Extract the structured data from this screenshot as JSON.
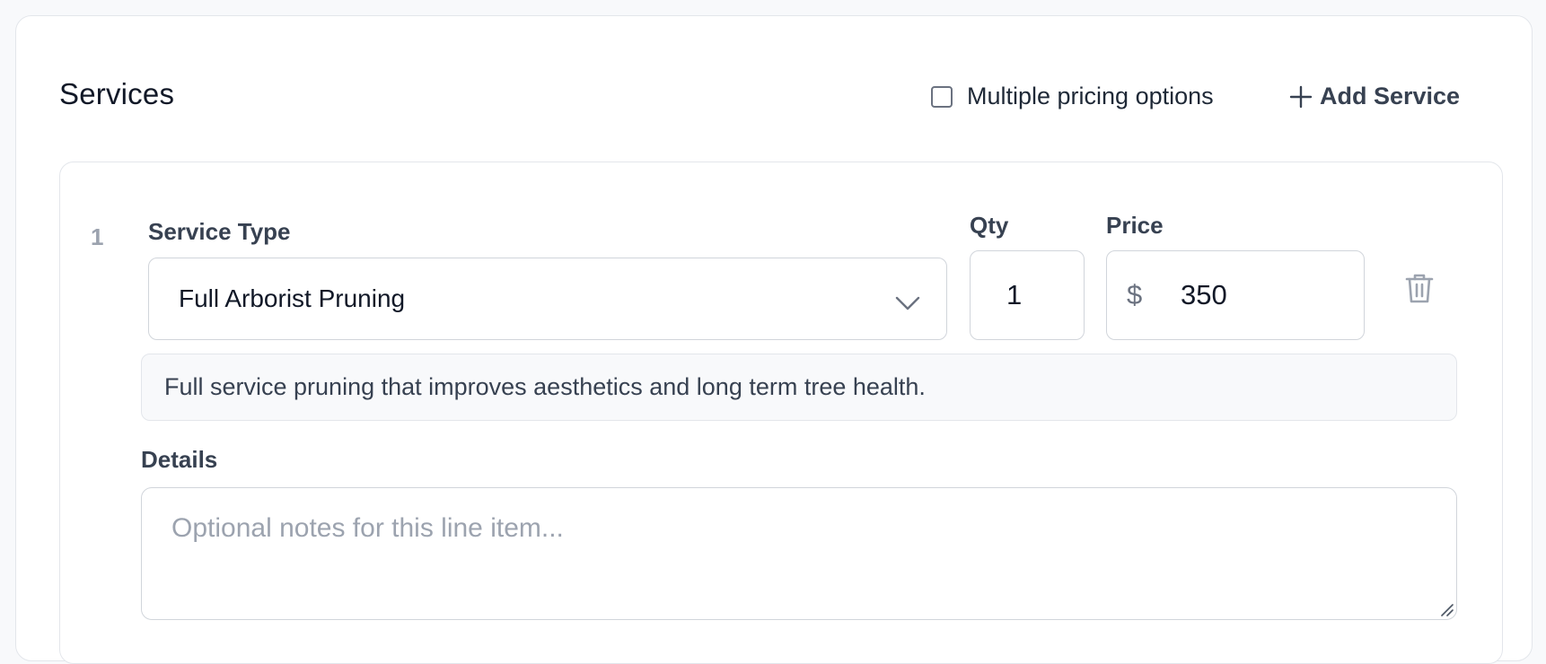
{
  "section": {
    "title": "Services",
    "multiple_pricing_label": "Multiple pricing options",
    "multiple_pricing_checked": false,
    "add_service_label": "Add Service"
  },
  "line_items": [
    {
      "number": "1",
      "service_type_label": "Service Type",
      "service_type_value": "Full Arborist Pruning",
      "qty_label": "Qty",
      "qty_value": "1",
      "price_label": "Price",
      "currency_symbol": "$",
      "price_value": "350",
      "description": "Full service pruning that improves aesthetics and long term tree health.",
      "details_label": "Details",
      "details_placeholder": "Optional notes for this line item...",
      "details_value": ""
    }
  ],
  "icons": {
    "add": "plus-icon",
    "dropdown": "chevron-down-icon",
    "delete": "trash-icon",
    "resize": "resize-handle-icon"
  },
  "colors": {
    "border": "#e3e6eb",
    "input_border": "#d1d5db",
    "muted_text": "#9ca3af",
    "label_text": "#374151"
  }
}
